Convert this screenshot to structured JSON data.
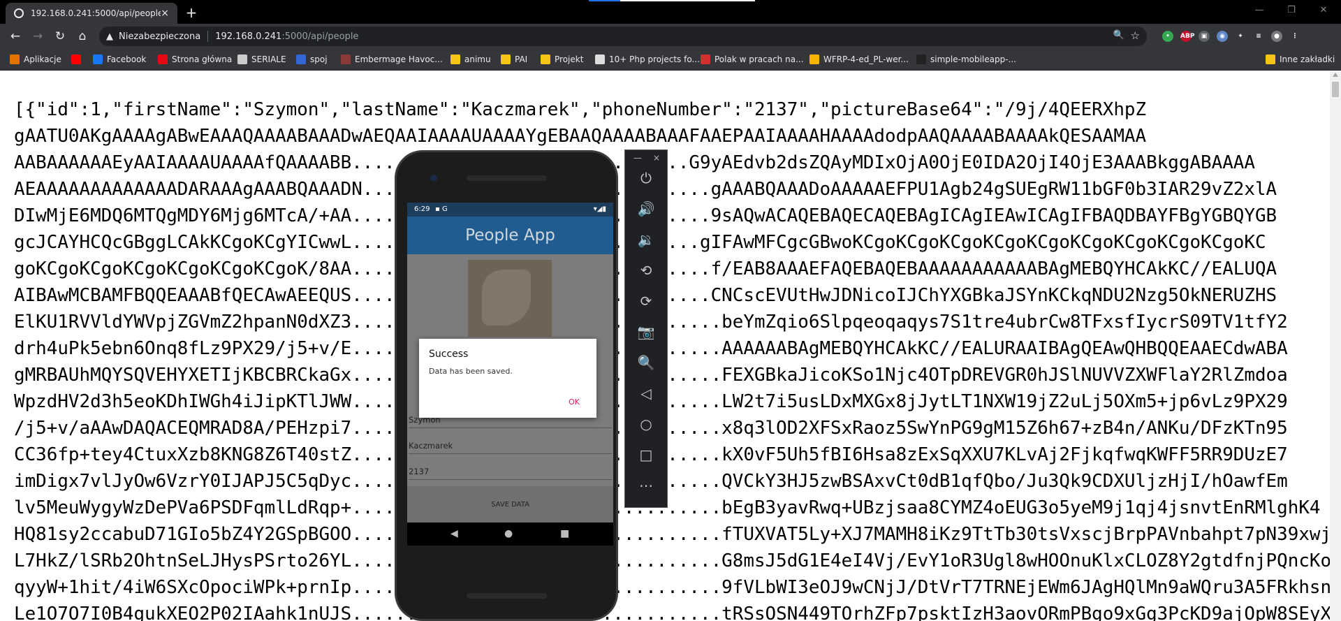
{
  "browser": {
    "tab_title": "192.168.0.241:5000/api/people",
    "tab_close": "×",
    "new_tab": "+",
    "window_controls": {
      "minimize": "—",
      "restore": "❐",
      "close": "✕"
    },
    "security_label": "Niezabezpieczona",
    "url_host": "192.168.0.241",
    "url_path": ":5000/api/people",
    "nav": {
      "back": "←",
      "forward": "→",
      "reload": "↻",
      "home": "⌂"
    },
    "extensions": [
      {
        "name": "green-extension-icon",
        "color": "#34a853",
        "glyph": "•"
      },
      {
        "name": "abp-extension-icon",
        "color": "#c70d2c",
        "glyph": "ABP"
      },
      {
        "name": "camera-extension-icon",
        "color": "#5f6368",
        "glyph": "▣"
      },
      {
        "name": "translate-extension-icon",
        "color": "#5f85c4",
        "glyph": "◉"
      },
      {
        "name": "puzzle-extension-icon",
        "color": "#35363a",
        "glyph": "✦"
      },
      {
        "name": "playlist-extension-icon",
        "color": "#35363a",
        "glyph": "≡"
      },
      {
        "name": "profile-avatar",
        "color": "#7a7a7a",
        "glyph": "●"
      },
      {
        "name": "menu-icon",
        "color": "#35363a",
        "glyph": "⋮"
      }
    ]
  },
  "bookmarks": [
    {
      "label": "Aplikacje",
      "icon": "apps-grid-icon",
      "color": "#e37400"
    },
    {
      "label": "",
      "icon": "youtube-icon",
      "color": "#ff0000"
    },
    {
      "label": "Facebook",
      "icon": "facebook-icon",
      "color": "#1877f2"
    },
    {
      "label": "Strona główna",
      "icon": "netflix-icon",
      "color": "#e50914"
    },
    {
      "label": "SERIALE",
      "icon": "tv-icon",
      "color": "#cccccc"
    },
    {
      "label": "spoj",
      "icon": "spoj-icon",
      "color": "#3367d6"
    },
    {
      "label": "Embermage Havoc...",
      "icon": "game-icon",
      "color": "#8b3a3a"
    },
    {
      "label": "animu",
      "icon": "folder-icon",
      "color": "#f5c518"
    },
    {
      "label": "PAI",
      "icon": "folder-icon",
      "color": "#f5c518"
    },
    {
      "label": "Projekt",
      "icon": "folder-icon",
      "color": "#f5c518"
    },
    {
      "label": "10+ Php projects fo...",
      "icon": "globe-icon",
      "color": "#dddddd"
    },
    {
      "label": "Polak w pracach na...",
      "icon": "news-icon",
      "color": "#d32f2f"
    },
    {
      "label": "WFRP-4-ed_PL-wer...",
      "icon": "drive-icon",
      "color": "#f4b400"
    },
    {
      "label": "simple-mobileapp-...",
      "icon": "github-icon",
      "color": "#222222"
    },
    {
      "label": "Inne zakładki",
      "icon": "folder-icon",
      "color": "#f5c518"
    }
  ],
  "page": {
    "json_lines": [
      "[{\"id\":1,\"firstName\":\"Szymon\",\"lastName\":\"Kaczmarek\",\"phoneNumber\":\"2137\",\"pictureBase64\":\"/9j/4QEERXhpZ",
      "gAATU0AKgAAAAgABwEAAAQAAAABAAADwAEQAAIAAAAUAAAAYgEBAAQAAAABAAAFAAEPAAIAAAAHAAAAdodpAAQAAAABAAAAkQESAAMAA",
      "AABAAAAAAEyAAIAAAAUAAAAfQAAAABB...............................G9yAEdvb2dsZQAyMDIxOjA0OjE0IDA2OjI4OjE3AAABkggABAAAA",
      "AEAAAAAAAAAAAAADARAAAgAAABQAAADN................................gAAABQAAADoAAAAAEFPU1Agb24gSUEgRW11bGF0b3IAR29vZ2xlA",
      "DIwMjE6MDQ6MTQgMDY6Mjg6MTcA/+AA.................................9sAQwACAQEBAQECAQEBAgICAgIEAwICAgIFBAQDBAYFBgYGBQYGB",
      "gcJCAYHCQcGBggLCAkKCgoKCgYICwwL................................gIFAwMFCgcGBwoKCgoKCgoKCgoKCgoKCgoKCgoKCgoKCgoKCgoKC",
      "goKCgoKCgoKCgoKCgoKCgoKCgoK/8AA.................................f/EAB8AAAEFAQEBAQEBAAAAAAAAAAABAgMEBQYHCAkKC//EALUQA",
      "AIBAwMCBAMFBQQEAAABfQECAwAEEQUS.................................CNCscEVUtHwJDNicoIJChYXGBkaJSYnKCkqNDU2Nzg5OkNERUZHS",
      "ElKU1RVVldYWVpjZGVmZ2hpanN0dXZ3..................................beYmZqio6Slpqeoqaqys7S1tre4ubrCw8TFxsfIycrS09TV1tfY2",
      "drh4uPk5ebn6Onq8fLz9PX29/j5+v/E..................................AAAAAABAgMEBQYHCAkKC//EALURAAIBAgQEAwQHBQQEAAECdwABA",
      "gMRBAUhMQYSQVEHYXETIjKBCBRCkaGx..................................FEXGBkaJicoKSo1Njc4OTpDREVGR0hJSlNUVVZXWFlaY2RlZmdoa",
      "WpzdHV2d3h5eoKDhIWGh4iJipKTlJWW..................................LW2t7i5usLDxMXGx8jJytLT1NXW19jZ2uLj5OXm5+jp6vLz9PX29",
      "/j5+v/aAAwDAQACEQMRAD8A/PEHzpi7..................................x8q3lOD2XFSxRaoz5SwYnPG9gM15Z6h67+zB4n/ANKu/DFzKTn95",
      "CC36fp+tey4CtuxXzb8KNG8Z6T40stZ..................................kX0vF5Uh5fBI6Hsa8zExSqXXU7KLvAj2FjkqfwqKWFF5RR9DUzE7",
      "imDigx7vlJyOw6VzrY0IJAPJ5C5qDyc..................................QVCkY3HJ5zwBSAxvCt0dB1qfQbo/Ju3Qk9CDXUljzHjI/hOawfEm",
      "lv5MeuWygyWzDePVa6PSDFqmlLdRqp+..................................bEgB3yavRwq+UBzjsaa8CYMZ4oEUG3o5yeM9j1qj4jsnvtEnRMlghK4",
      "HQ81sy2ccabuD71GIo5bZ4Y2GSpBGOO..................................fTUXVAT5Ly+XJ7MAMH8iKz9TtTb30tsVxscjBrpPAVnbahpt7pN39xwj",
      "L7HkZ/lSRb2OhtnSeLJHysPSrto26YL..................................G8msJ5dG1E4eI4Vj/EvY1oR3Ugl8wHOOnuKlxCLOZ8Y2gtdfnjPQncKo",
      "qyyW+1hit/4iW6SXcOpociWPk+prnIp..................................9fVLbWI3eOJ9wCNjJ/DtVrT7TRNEjEWm6JAgHQlMn9aWQru3A5FRkhsn",
      "Le1O7O7I0B4gukXEO2P02IAahk1nUJS..................................tRSsOSN449TOrhZFp7psktIzH3aovORmPBgo9xGg3PcKD9ajOpW8SEyX"
    ]
  },
  "emulator": {
    "status_time": "6:29",
    "status_icons_left": "▪ G",
    "status_icons_right": "▾◢▮",
    "app_title": "People App",
    "fields": [
      "Szymon",
      "Kaczmarek",
      "2137"
    ],
    "save_button": "SAVE DATA",
    "nav": {
      "back": "◀",
      "home": "●",
      "recents": "■"
    },
    "dialog": {
      "title": "Success",
      "message": "Data has been saved.",
      "ok": "OK"
    },
    "panel_top": {
      "minimize": "—",
      "close": "×"
    },
    "panel_buttons": [
      {
        "name": "power-icon",
        "glyph": "⏻"
      },
      {
        "name": "volume-up-icon",
        "glyph": "🔊"
      },
      {
        "name": "volume-down-icon",
        "glyph": "🔉"
      },
      {
        "name": "rotate-left-icon",
        "glyph": "⟲"
      },
      {
        "name": "rotate-right-icon",
        "glyph": "⟳"
      },
      {
        "name": "camera-icon",
        "glyph": "📷"
      },
      {
        "name": "zoom-icon",
        "glyph": "🔍"
      },
      {
        "name": "back-icon",
        "glyph": "◁"
      },
      {
        "name": "home-icon",
        "glyph": "○"
      },
      {
        "name": "overview-icon",
        "glyph": "□"
      },
      {
        "name": "more-icon",
        "glyph": "⋯"
      }
    ]
  }
}
